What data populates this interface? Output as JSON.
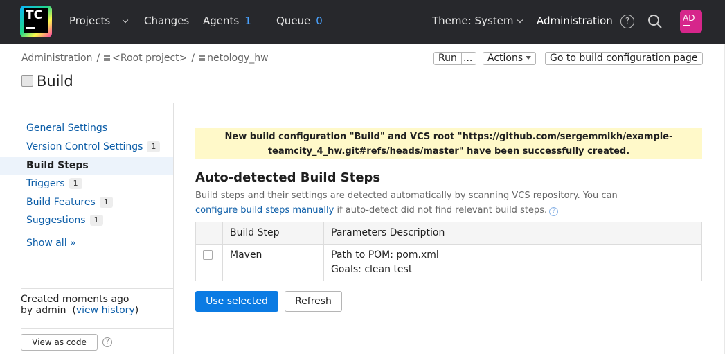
{
  "topbar": {
    "logo_text": "TC",
    "projects_label": "Projects",
    "changes_label": "Changes",
    "agents_label": "Agents",
    "agents_count": "1",
    "queue_label": "Queue",
    "queue_count": "0",
    "theme_label": "Theme: System",
    "administration_label": "Administration",
    "help_glyph": "?",
    "avatar_initials": "AD"
  },
  "breadcrumb": {
    "items": [
      "Administration",
      "<Root project>",
      "netology_hw"
    ],
    "separator": "/"
  },
  "header": {
    "run_label": "Run",
    "run_more_label": "...",
    "actions_label": "Actions",
    "goto_label": "Go to build configuration page",
    "title": "Build"
  },
  "sidebar": {
    "items": [
      {
        "label": "General Settings",
        "badge": ""
      },
      {
        "label": "Version Control Settings",
        "badge": "1"
      },
      {
        "label": "Build Steps",
        "badge": ""
      },
      {
        "label": "Triggers",
        "badge": "1"
      },
      {
        "label": "Build Features",
        "badge": "1"
      },
      {
        "label": "Suggestions",
        "badge": "1"
      }
    ],
    "show_all": "Show all »",
    "created_line1": "Created moments ago",
    "created_by": "by admin",
    "view_history": "view history",
    "view_as_code": "View as code"
  },
  "main": {
    "banner_line1": "New build configuration \"Build\" and VCS root \"https://github.com/sergemmikh/example-",
    "banner_line2": "teamcity_4_hw.git#refs/heads/master\" have been successfully created.",
    "section_title": "Auto-detected Build Steps",
    "desc_line1": "Build steps and their settings are detected automatically by scanning VCS repository. You can",
    "desc_link": "configure build steps manually",
    "desc_rest": " if auto-detect did not find relevant build steps.",
    "table": {
      "headers": [
        "Build Step",
        "Parameters Description"
      ],
      "rows": [
        {
          "step": "Maven",
          "param1": "Path to POM: pom.xml",
          "param2": "Goals: clean test",
          "checked": false
        }
      ]
    },
    "use_selected_label": "Use selected",
    "refresh_label": "Refresh"
  },
  "colors": {
    "topbar_bg": "#27282c",
    "link": "#0d5ea8",
    "primary": "#0b7be3",
    "banner_bg": "#fff9c9",
    "avatar_bg": "#d6268b"
  },
  "icons": [
    "teamcity-logo-icon",
    "chevron-down-icon",
    "help-icon",
    "search-icon",
    "project-icon",
    "build-config-icon",
    "caret-down-icon"
  ]
}
